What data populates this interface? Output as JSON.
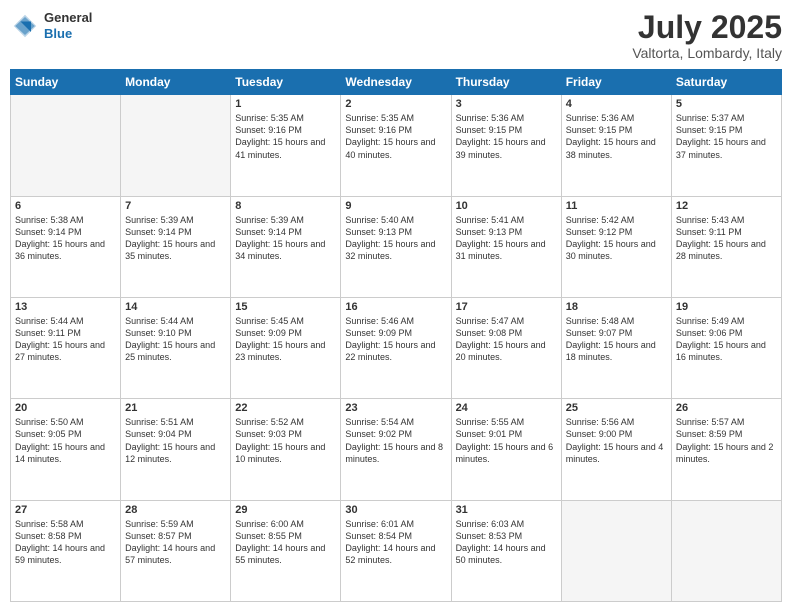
{
  "header": {
    "logo": {
      "general": "General",
      "blue": "Blue"
    },
    "title": "July 2025",
    "location": "Valtorta, Lombardy, Italy"
  },
  "weekdays": [
    "Sunday",
    "Monday",
    "Tuesday",
    "Wednesday",
    "Thursday",
    "Friday",
    "Saturday"
  ],
  "weeks": [
    [
      {
        "day": "",
        "sunrise": "",
        "sunset": "",
        "daylight": "",
        "empty": true
      },
      {
        "day": "",
        "sunrise": "",
        "sunset": "",
        "daylight": "",
        "empty": true
      },
      {
        "day": "1",
        "sunrise": "Sunrise: 5:35 AM",
        "sunset": "Sunset: 9:16 PM",
        "daylight": "Daylight: 15 hours and 41 minutes.",
        "empty": false
      },
      {
        "day": "2",
        "sunrise": "Sunrise: 5:35 AM",
        "sunset": "Sunset: 9:16 PM",
        "daylight": "Daylight: 15 hours and 40 minutes.",
        "empty": false
      },
      {
        "day": "3",
        "sunrise": "Sunrise: 5:36 AM",
        "sunset": "Sunset: 9:15 PM",
        "daylight": "Daylight: 15 hours and 39 minutes.",
        "empty": false
      },
      {
        "day": "4",
        "sunrise": "Sunrise: 5:36 AM",
        "sunset": "Sunset: 9:15 PM",
        "daylight": "Daylight: 15 hours and 38 minutes.",
        "empty": false
      },
      {
        "day": "5",
        "sunrise": "Sunrise: 5:37 AM",
        "sunset": "Sunset: 9:15 PM",
        "daylight": "Daylight: 15 hours and 37 minutes.",
        "empty": false
      }
    ],
    [
      {
        "day": "6",
        "sunrise": "Sunrise: 5:38 AM",
        "sunset": "Sunset: 9:14 PM",
        "daylight": "Daylight: 15 hours and 36 minutes.",
        "empty": false
      },
      {
        "day": "7",
        "sunrise": "Sunrise: 5:39 AM",
        "sunset": "Sunset: 9:14 PM",
        "daylight": "Daylight: 15 hours and 35 minutes.",
        "empty": false
      },
      {
        "day": "8",
        "sunrise": "Sunrise: 5:39 AM",
        "sunset": "Sunset: 9:14 PM",
        "daylight": "Daylight: 15 hours and 34 minutes.",
        "empty": false
      },
      {
        "day": "9",
        "sunrise": "Sunrise: 5:40 AM",
        "sunset": "Sunset: 9:13 PM",
        "daylight": "Daylight: 15 hours and 32 minutes.",
        "empty": false
      },
      {
        "day": "10",
        "sunrise": "Sunrise: 5:41 AM",
        "sunset": "Sunset: 9:13 PM",
        "daylight": "Daylight: 15 hours and 31 minutes.",
        "empty": false
      },
      {
        "day": "11",
        "sunrise": "Sunrise: 5:42 AM",
        "sunset": "Sunset: 9:12 PM",
        "daylight": "Daylight: 15 hours and 30 minutes.",
        "empty": false
      },
      {
        "day": "12",
        "sunrise": "Sunrise: 5:43 AM",
        "sunset": "Sunset: 9:11 PM",
        "daylight": "Daylight: 15 hours and 28 minutes.",
        "empty": false
      }
    ],
    [
      {
        "day": "13",
        "sunrise": "Sunrise: 5:44 AM",
        "sunset": "Sunset: 9:11 PM",
        "daylight": "Daylight: 15 hours and 27 minutes.",
        "empty": false
      },
      {
        "day": "14",
        "sunrise": "Sunrise: 5:44 AM",
        "sunset": "Sunset: 9:10 PM",
        "daylight": "Daylight: 15 hours and 25 minutes.",
        "empty": false
      },
      {
        "day": "15",
        "sunrise": "Sunrise: 5:45 AM",
        "sunset": "Sunset: 9:09 PM",
        "daylight": "Daylight: 15 hours and 23 minutes.",
        "empty": false
      },
      {
        "day": "16",
        "sunrise": "Sunrise: 5:46 AM",
        "sunset": "Sunset: 9:09 PM",
        "daylight": "Daylight: 15 hours and 22 minutes.",
        "empty": false
      },
      {
        "day": "17",
        "sunrise": "Sunrise: 5:47 AM",
        "sunset": "Sunset: 9:08 PM",
        "daylight": "Daylight: 15 hours and 20 minutes.",
        "empty": false
      },
      {
        "day": "18",
        "sunrise": "Sunrise: 5:48 AM",
        "sunset": "Sunset: 9:07 PM",
        "daylight": "Daylight: 15 hours and 18 minutes.",
        "empty": false
      },
      {
        "day": "19",
        "sunrise": "Sunrise: 5:49 AM",
        "sunset": "Sunset: 9:06 PM",
        "daylight": "Daylight: 15 hours and 16 minutes.",
        "empty": false
      }
    ],
    [
      {
        "day": "20",
        "sunrise": "Sunrise: 5:50 AM",
        "sunset": "Sunset: 9:05 PM",
        "daylight": "Daylight: 15 hours and 14 minutes.",
        "empty": false
      },
      {
        "day": "21",
        "sunrise": "Sunrise: 5:51 AM",
        "sunset": "Sunset: 9:04 PM",
        "daylight": "Daylight: 15 hours and 12 minutes.",
        "empty": false
      },
      {
        "day": "22",
        "sunrise": "Sunrise: 5:52 AM",
        "sunset": "Sunset: 9:03 PM",
        "daylight": "Daylight: 15 hours and 10 minutes.",
        "empty": false
      },
      {
        "day": "23",
        "sunrise": "Sunrise: 5:54 AM",
        "sunset": "Sunset: 9:02 PM",
        "daylight": "Daylight: 15 hours and 8 minutes.",
        "empty": false
      },
      {
        "day": "24",
        "sunrise": "Sunrise: 5:55 AM",
        "sunset": "Sunset: 9:01 PM",
        "daylight": "Daylight: 15 hours and 6 minutes.",
        "empty": false
      },
      {
        "day": "25",
        "sunrise": "Sunrise: 5:56 AM",
        "sunset": "Sunset: 9:00 PM",
        "daylight": "Daylight: 15 hours and 4 minutes.",
        "empty": false
      },
      {
        "day": "26",
        "sunrise": "Sunrise: 5:57 AM",
        "sunset": "Sunset: 8:59 PM",
        "daylight": "Daylight: 15 hours and 2 minutes.",
        "empty": false
      }
    ],
    [
      {
        "day": "27",
        "sunrise": "Sunrise: 5:58 AM",
        "sunset": "Sunset: 8:58 PM",
        "daylight": "Daylight: 14 hours and 59 minutes.",
        "empty": false
      },
      {
        "day": "28",
        "sunrise": "Sunrise: 5:59 AM",
        "sunset": "Sunset: 8:57 PM",
        "daylight": "Daylight: 14 hours and 57 minutes.",
        "empty": false
      },
      {
        "day": "29",
        "sunrise": "Sunrise: 6:00 AM",
        "sunset": "Sunset: 8:55 PM",
        "daylight": "Daylight: 14 hours and 55 minutes.",
        "empty": false
      },
      {
        "day": "30",
        "sunrise": "Sunrise: 6:01 AM",
        "sunset": "Sunset: 8:54 PM",
        "daylight": "Daylight: 14 hours and 52 minutes.",
        "empty": false
      },
      {
        "day": "31",
        "sunrise": "Sunrise: 6:03 AM",
        "sunset": "Sunset: 8:53 PM",
        "daylight": "Daylight: 14 hours and 50 minutes.",
        "empty": false
      },
      {
        "day": "",
        "sunrise": "",
        "sunset": "",
        "daylight": "",
        "empty": true
      },
      {
        "day": "",
        "sunrise": "",
        "sunset": "",
        "daylight": "",
        "empty": true
      }
    ]
  ]
}
